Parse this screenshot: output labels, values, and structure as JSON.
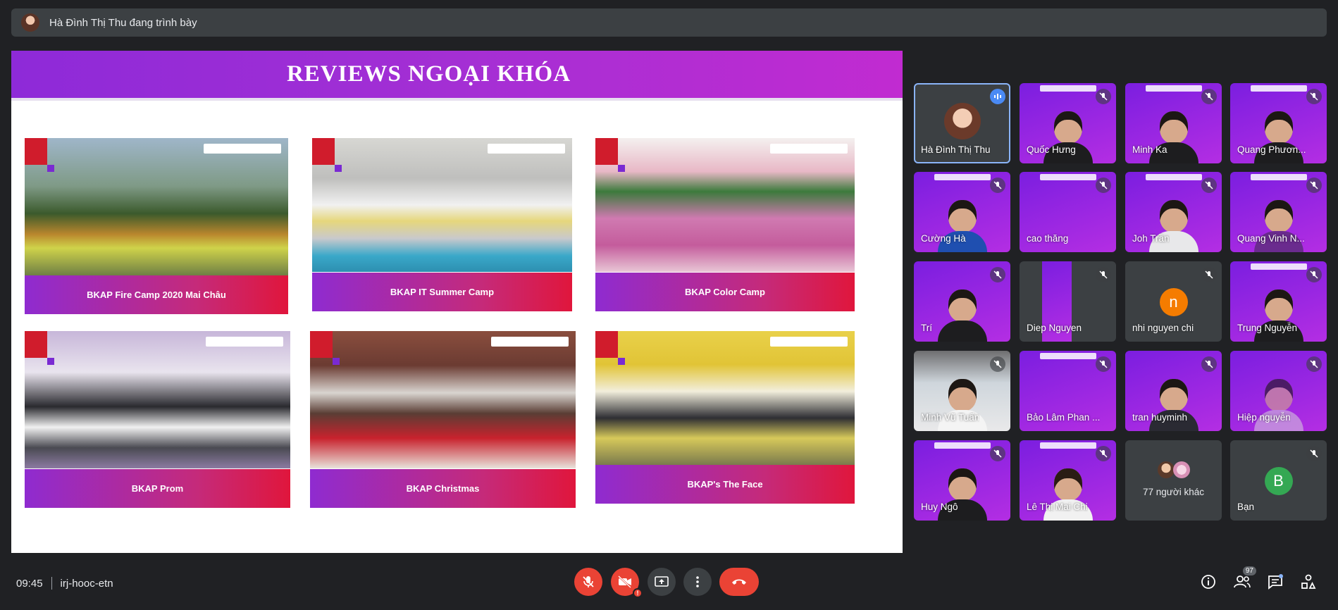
{
  "header": {
    "presenter_text": "Hà Đình Thị Thu đang trình bày"
  },
  "slide": {
    "title": "REVIEWS NGOẠI KHÓA",
    "cards": [
      {
        "caption": "BKAP Fire Camp 2020 Mai Châu"
      },
      {
        "caption": "BKAP IT Summer Camp"
      },
      {
        "caption": "BKAP Color Camp"
      },
      {
        "caption": "BKAP Prom"
      },
      {
        "caption": "BKAP Christmas"
      },
      {
        "caption": "BKAP's The Face"
      }
    ]
  },
  "participants": [
    {
      "name": "Hà Đình Thị Thu"
    },
    {
      "name": "Quốc Hưng"
    },
    {
      "name": "Minh Ka"
    },
    {
      "name": "Quang Phươn..."
    },
    {
      "name": "Cường Hà"
    },
    {
      "name": "cao thăng"
    },
    {
      "name": "Joh Trần"
    },
    {
      "name": "Quang Vinh N..."
    },
    {
      "name": "Trí"
    },
    {
      "name": "Diep Nguyen"
    },
    {
      "name": "nhi nguyen chi",
      "initial": "n"
    },
    {
      "name": "Trung Nguyễn"
    },
    {
      "name": "Minh Vũ Tuấn"
    },
    {
      "name": "Bảo Lâm Phan ..."
    },
    {
      "name": "tran huyminh"
    },
    {
      "name": "Hiệp nguyễn"
    },
    {
      "name": "Huy Ngô"
    },
    {
      "name": "Lê Thị Mai Chi"
    },
    {
      "name": "77 người khác"
    },
    {
      "name": "Bạn",
      "initial": "B"
    }
  ],
  "footer": {
    "time": "09:45",
    "meeting_code": "irj-hooc-etn",
    "people_count": "97"
  },
  "colors": {
    "accent_red": "#ea4335",
    "speaking_blue": "#4a8af4",
    "letter_avatar_orange": "#f57c00",
    "letter_avatar_green": "#34a853"
  }
}
